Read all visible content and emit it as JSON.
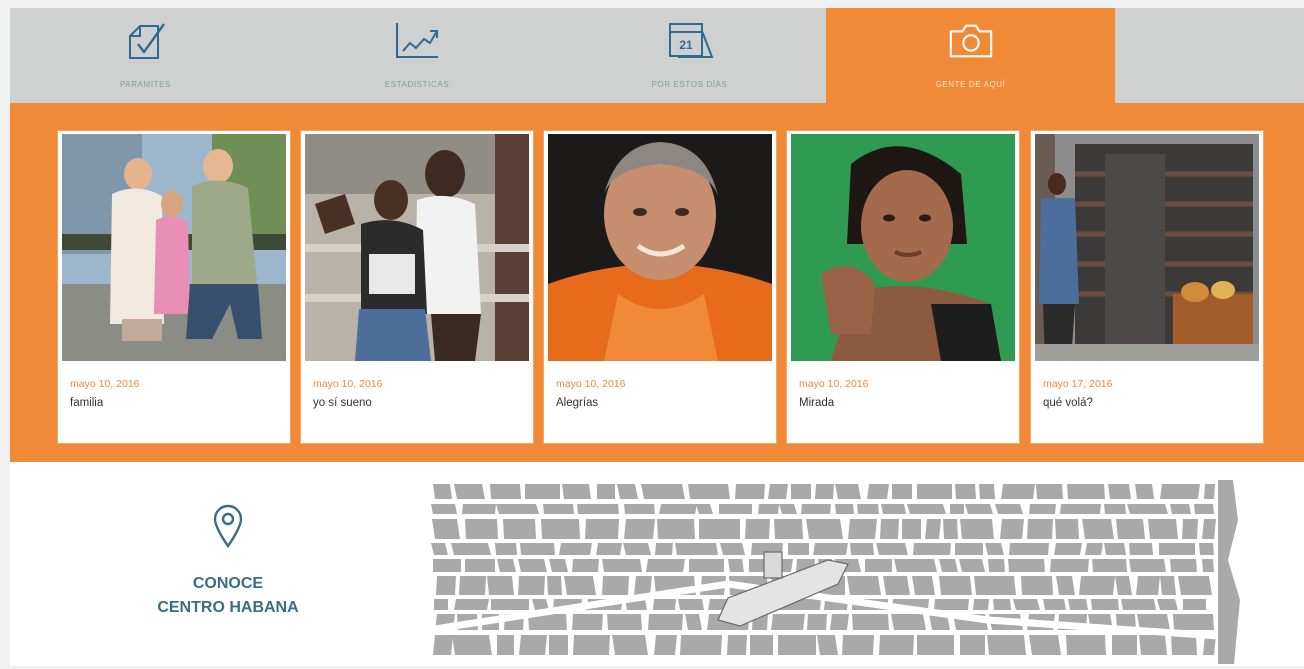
{
  "tabs": [
    {
      "label": "PARAMITES",
      "icon": "checklist-icon",
      "active": false
    },
    {
      "label": "ESTADISTICAS",
      "icon": "chart-icon",
      "active": false
    },
    {
      "label": "POR ESTOS DÍAS",
      "icon": "calendar-icon",
      "active": false,
      "calendar_day": "21"
    },
    {
      "label": "GENTE DE AQUÍ",
      "icon": "camera-icon",
      "active": true
    }
  ],
  "cards": [
    {
      "date": "mayo 10, 2016",
      "caption": "familia"
    },
    {
      "date": "mayo 10, 2016",
      "caption": "yo sí sueno"
    },
    {
      "date": "mayo 10, 2016",
      "caption": "Alegrías"
    },
    {
      "date": "mayo 10, 2016",
      "caption": "Mirada"
    },
    {
      "date": "mayo 17, 2016",
      "caption": "qué volá?"
    }
  ],
  "conoce": {
    "line1": "CONOCE",
    "line2": "CENTRO HABANA"
  },
  "colors": {
    "accent": "#f08a36",
    "tab_bg": "#cfd0d0",
    "icon": "#2f6b8f"
  }
}
